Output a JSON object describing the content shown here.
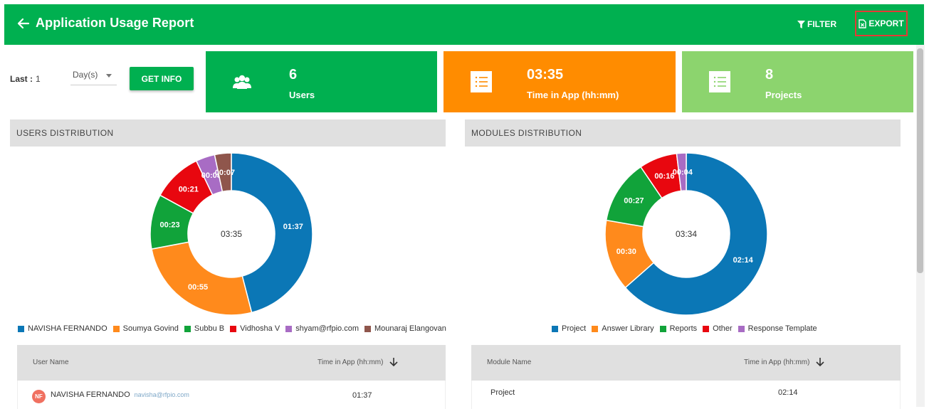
{
  "header": {
    "title": "Application Usage Report",
    "filter_label": "FILTER",
    "export_label": "EXPORT"
  },
  "filters": {
    "last_label": "Last :",
    "last_value": "1",
    "unit_value": "Day(s)",
    "get_info_label": "GET INFO"
  },
  "cards": [
    {
      "value": "6",
      "label": "Users",
      "icon": "users-icon",
      "color": "#00b050"
    },
    {
      "value": "03:35",
      "label": "Time in App (hh:mm)",
      "icon": "list-icon",
      "color": "#ff8c00"
    },
    {
      "value": "8",
      "label": "Projects",
      "icon": "list-icon",
      "color": "#8cd46e"
    }
  ],
  "users_distribution": {
    "heading": "USERS DISTRIBUTION",
    "total": "03:35",
    "slices": [
      {
        "name": "NAVISHA FERNANDO",
        "label": "01:37",
        "minutes": 97,
        "color": "#0b77b6"
      },
      {
        "name": "Soumya Govind",
        "label": "00:55",
        "minutes": 55,
        "color": "#ff8a1c"
      },
      {
        "name": "Subbu B",
        "label": "00:23",
        "minutes": 23,
        "color": "#11a33a"
      },
      {
        "name": "Vidhosha V",
        "label": "00:21",
        "minutes": 21,
        "color": "#e8070f"
      },
      {
        "name": "shyam@rfpio.com",
        "label": "00:08",
        "minutes": 8,
        "color": "#a86cc4"
      },
      {
        "name": "Mounaraj Elangovan",
        "label": "00:07",
        "minutes": 7,
        "color": "#8f564c"
      }
    ]
  },
  "modules_distribution": {
    "heading": "MODULES DISTRIBUTION",
    "total": "03:34",
    "slices": [
      {
        "name": "Project",
        "label": "02:14",
        "minutes": 134,
        "color": "#0b77b6"
      },
      {
        "name": "Answer Library",
        "label": "00:30",
        "minutes": 30,
        "color": "#ff8a1c"
      },
      {
        "name": "Reports",
        "label": "00:27",
        "minutes": 27,
        "color": "#11a33a"
      },
      {
        "name": "Other",
        "label": "00:16",
        "minutes": 16,
        "color": "#e8070f"
      },
      {
        "name": "Response Template",
        "label": "00:04",
        "minutes": 4,
        "color": "#a86cc4"
      }
    ]
  },
  "users_table": {
    "col_name": "User Name",
    "col_time": "Time in App (hh:mm)",
    "rows": [
      {
        "initials": "NF",
        "name": "NAVISHA FERNANDO",
        "email": "navisha@rfpio.com",
        "time": "01:37"
      }
    ]
  },
  "modules_table": {
    "col_name": "Module Name",
    "col_time": "Time in App (hh:mm)",
    "rows": [
      {
        "name": "Project",
        "time": "02:14"
      }
    ]
  }
}
